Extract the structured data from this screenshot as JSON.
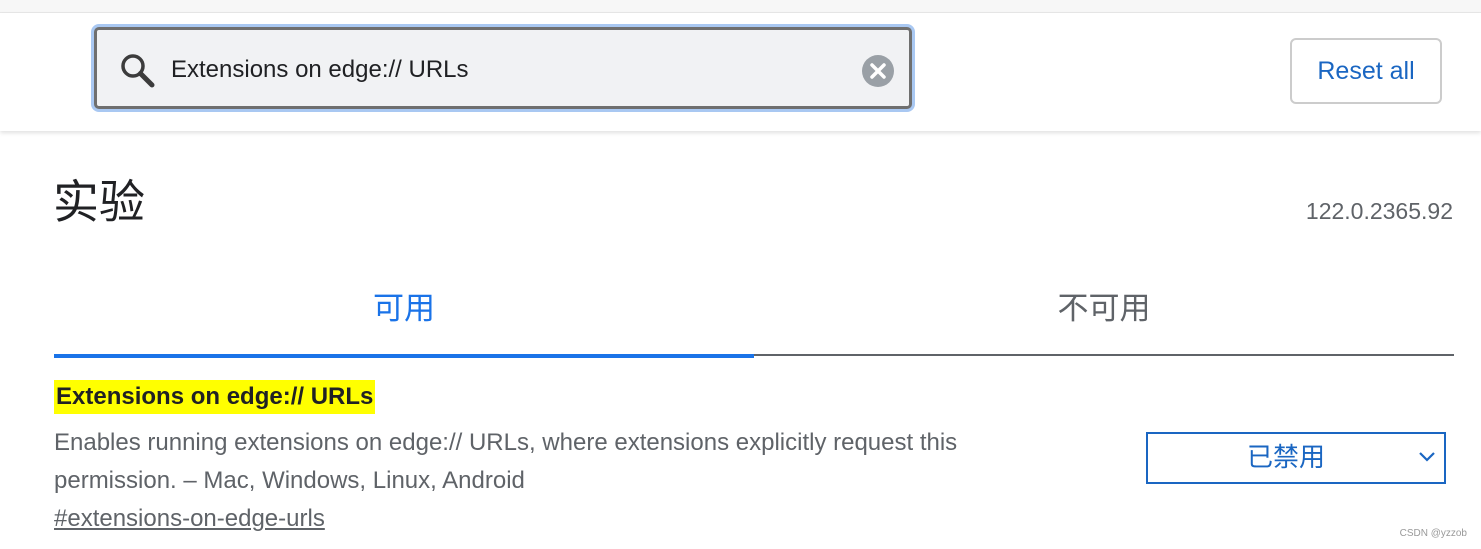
{
  "search": {
    "value": "Extensions on edge:// URLs"
  },
  "header": {
    "reset_label": "Reset all"
  },
  "page": {
    "title": "实验",
    "version": "122.0.2365.92"
  },
  "tabs": [
    {
      "label": "可用",
      "active": true
    },
    {
      "label": "不可用",
      "active": false
    }
  ],
  "flag": {
    "title": "Extensions on edge:// URLs",
    "description_line1": "Enables running extensions on edge:// URLs, where extensions explicitly request this",
    "description_line2": "permission. – Mac, Windows, Linux, Android",
    "link": "#extensions-on-edge-urls",
    "selected_option": "已禁用"
  },
  "watermark": "CSDN @yzzob",
  "colors": {
    "accent": "#1a73e8",
    "highlight": "#ffff00",
    "secondary_text": "#5f6368"
  },
  "icons": {
    "search": "search-icon",
    "clear": "clear-icon",
    "dropdown": "chevron-down-icon"
  }
}
